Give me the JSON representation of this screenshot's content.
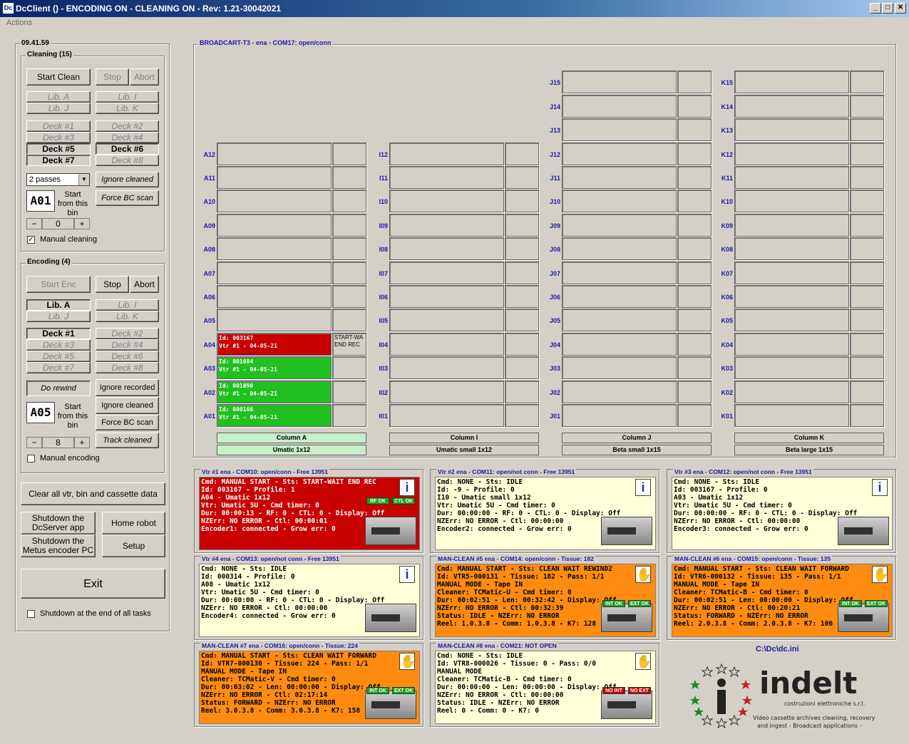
{
  "window": {
    "title": "DcClient () - ENCODING ON - CLEANING ON - Rev: 1.21-30042021",
    "app_icon": "Dc",
    "min": "_",
    "max": "□",
    "close": "✕"
  },
  "menu": {
    "actions": "Actions"
  },
  "clock": "09.41.59",
  "cleaning": {
    "title": "Cleaning (15)",
    "start": "Start Clean",
    "stop": "Stop",
    "abort": "Abort",
    "lib_a": "Lib. A",
    "lib_j": "Lib. J",
    "lib_i": "Lib. I",
    "lib_k": "Lib. K",
    "deck1": "Deck #1",
    "deck2": "Deck #2",
    "deck3": "Deck #3",
    "deck4": "Deck #4",
    "deck5": "Deck #5",
    "deck6": "Deck #6",
    "deck7": "Deck #7",
    "deck8": "Deck #8",
    "passes": "2 passes",
    "ignore_cleaned": "Ignore cleaned",
    "force_bc": "Force BC scan",
    "bin": "A01",
    "start_from": "Start from this bin",
    "spin_minus": "−",
    "spin_value": "0",
    "spin_plus": "+",
    "manual_label": "Manual cleaning",
    "manual_checked": "✓"
  },
  "encoding": {
    "title": "Encoding (4)",
    "start": "Start Enc",
    "stop": "Stop",
    "abort": "Abort",
    "lib_a": "Lib. A",
    "lib_j": "Lib. J",
    "lib_i": "Lib. I",
    "lib_k": "Lib. K",
    "deck1": "Deck #1",
    "deck2": "Deck #2",
    "deck3": "Deck #3",
    "deck4": "Deck #4",
    "deck5": "Deck #5",
    "deck6": "Deck #6",
    "deck7": "Deck #7",
    "deck8": "Deck #8",
    "do_rewind": "Do rewind",
    "ignore_recorded": "Ignore recorded",
    "ignore_cleaned": "Ignore cleaned",
    "force_bc": "Force BC scan",
    "track_cleaned": "Track cleaned",
    "bin": "A05",
    "start_from": "Start from this bin",
    "spin_minus": "−",
    "spin_value": "8",
    "spin_plus": "+",
    "manual_label": "Manual encoding"
  },
  "actions": {
    "clear": "Clear all vtr, bin and cassette data",
    "shutdown_dc": "Shutdown the DcServer app",
    "home_robot": "Home robot",
    "shutdown_metus": "Shutdown the Metus encoder PC",
    "setup": "Setup",
    "exit": "Exit",
    "shutdown_end": "Shutdown at the end of all tasks"
  },
  "robot": {
    "title": "BROADCART-T3 - ena - COM17: open/conn",
    "colA": {
      "name": "Column A",
      "type": "Umatic 1x12",
      "rows": [
        "A12",
        "A11",
        "A10",
        "A09",
        "A08",
        "A07",
        "A06",
        "A05",
        "A04",
        "A03",
        "A02",
        "A01"
      ]
    },
    "colI": {
      "name": "Column I",
      "type": "Umatic small 1x12",
      "rows": [
        "I12",
        "I11",
        "I10",
        "I09",
        "I08",
        "I07",
        "I06",
        "I05",
        "I04",
        "I03",
        "I02",
        "I01"
      ]
    },
    "colJ": {
      "name": "Column J",
      "type": "Beta small 1x15",
      "rows": [
        "J15",
        "J14",
        "J13",
        "J12",
        "J11",
        "J10",
        "J09",
        "J08",
        "J07",
        "J06",
        "J05",
        "J04",
        "J03",
        "J02",
        "J01"
      ]
    },
    "colK": {
      "name": "Column K",
      "type": "Beta large 1x15",
      "rows": [
        "K15",
        "K14",
        "K13",
        "K12",
        "K11",
        "K10",
        "K09",
        "K08",
        "K07",
        "K06",
        "K05",
        "K04",
        "K03",
        "K02",
        "K01"
      ]
    },
    "a04": {
      "l1": "Id: 003167",
      "l2": "Vtr #1 - 04-05-21",
      "side": "START-WA END REC"
    },
    "a03": {
      "l1": "Id: 001084",
      "l2": "Vtr #1 - 04-05-21"
    },
    "a02": {
      "l1": "Id: 001090",
      "l2": "Vtr #1 - 04-05-21"
    },
    "a01": {
      "l1": "Id: 000166",
      "l2": "Vtr #1 - 04-05-21"
    }
  },
  "vtrs": [
    {
      "hd": "Vtr #1 ena - COM10: open/conn - Free 13951",
      "lines": [
        "Cmd: MANUAL START - Sts: START-WAIT END REC",
        "Id: 003167 - Profile: 1",
        "A04 - Umatic 1x12",
        "Vtr: Umatic 5U - Cmd timer: 0",
        "Dur: 00:00:13 - RF: 0 - CTL: 0 - Display: Off",
        "NZErr: NO ERROR - Ctl: 00:00:01",
        "Encoder1: connected - Grow err: 0"
      ],
      "ok1": "RF OK",
      "ok2": "CTL OK"
    },
    {
      "hd": "Vtr #2 ena - COM11: open/not conn - Free 13951",
      "lines": [
        "Cmd: NONE - Sts: IDLE",
        "Id: -9 - Profile: 0",
        "I10 - Umatic small 1x12",
        "Vtr: Umatic 5U - Cmd timer: 0",
        "Dur: 00:00:00 - RF: 0 - CTL: 0 - Display: Off",
        "NZErr: NO ERROR - Ctl: 00:00:00",
        "Encoder2: connected - Grow err: 0"
      ]
    },
    {
      "hd": "Vtr #3 ena - COM12: open/not conn - Free 13951",
      "lines": [
        "Cmd: NONE - Sts: IDLE",
        "Id: 003167 - Profile: 0",
        "A03 - Umatic 1x12",
        "Vtr: Umatic 5U - Cmd timer: 0",
        "Dur: 00:00:00 - RF: 0 - CTL: 0 - Display: Off",
        "NZErr: NO ERROR - Ctl: 00:00:00",
        "Encoder3: connected - Grow err: 0"
      ]
    },
    {
      "hd": "Vtr #4 ena - COM13: open/not conn - Free 13951",
      "lines": [
        "Cmd: NONE - Sts: IDLE",
        "Id: 000314 - Profile: 0",
        "A08 - Umatic 1x12",
        "Vtr: Umatic 5U - Cmd timer: 0",
        "Dur: 00:00:00 - RF: 0 - CTL: 0 - Display: Off",
        "NZErr: NO ERROR - Ctl: 00:00:00",
        "Encoder4: connected - Grow err: 0"
      ]
    },
    {
      "hd": "MAN-CLEAN #5 ena - COM14: open/conn - Tissue: 182",
      "lines": [
        "Cmd: MANUAL START - Sts: CLEAN WAIT REWIND2",
        "Id: VTR5-000131 - Tissue: 182 - Pass: 1/1",
        "MANUAL MODE - Tape IN",
        "Cleaner: TCMatic-U - Cmd timer: 0",
        "Dur: 00:02:51 - Len: 00:32:42 - Display: Off",
        "NZErr: NO ERROR - Ctl: 00:32:39",
        "Status: IDLE - NZErr: NO ERROR",
        "Reel: 1.0.3.8 - Comm: 1.0.3.8 - K7: 128"
      ],
      "ok1": "INT OK",
      "ok2": "EXT OK"
    },
    {
      "hd": "MAN-CLEAN #6 ena - COM15: open/conn - Tissue: 135",
      "lines": [
        "Cmd: MANUAL START - Sts: CLEAN WAIT FORWARD",
        "Id: VTR6-000132 - Tissue: 135 - Pass: 1/1",
        "MANUAL MODE - Tape IN",
        "Cleaner: TCMatic-B - Cmd timer: 0",
        "Dur: 00:02:51 - Len: 00:00:00 - Display: Off",
        "NZErr: NO ERROR - Ctl: 00:20:21",
        "Status: FORWARD - NZErr: NO ERROR",
        "Reel: 2.0.3.8 - Comm: 2.0.3.8 - K7: 106"
      ],
      "ok1": "INT OK",
      "ok2": "EXT OK"
    },
    {
      "hd": "MAN-CLEAN #7 ena - COM16: open/conn - Tissue: 224",
      "lines": [
        "Cmd: MANUAL START - Sts: CLEAN WAIT FORWARD",
        "Id: VTR7-000130 - Tissue: 224 - Pass: 1/1",
        "MANUAL MODE - Tape IN",
        "Cleaner: TCMatic-V - Cmd timer: 0",
        "Dur: 00:03:02 - Len: 00:00:00 - Display: Off",
        "NZErr: NO ERROR - Ctl: 02:17:14",
        "Status: FORWARD - NZErr: NO ERROR",
        "Reel: 3.0.3.8 - Comm: 3.0.3.8 - K7: 158"
      ],
      "ok1": "INT OK",
      "ok2": "EXT OK"
    },
    {
      "hd": "MAN-CLEAN #8 ena - COM21: NOT OPEN",
      "lines": [
        "Cmd: NONE - Sts: IDLE",
        "Id: VTR8-000026 - Tissue: 0 - Pass: 0/0",
        "MANUAL MODE",
        "Cleaner: TCMatic-B - Cmd timer: 0",
        "Dur: 00:00:00 - Len: 00:00:00 - Display: Off",
        "NZErr: NO ERROR - Ctl: 00:00:00",
        "Status: IDLE - NZErr: NO ERROR",
        "Reel: 0 - Comm: 0 - K7: 0"
      ],
      "ok1": "NO INT",
      "ok2": "NO EXT"
    }
  ],
  "ini": "C:\\Dc\\dc.ini",
  "logo": {
    "name": "indelt",
    "sub": "costruzioni elettroniche s.r.l.",
    "tag1": "Video cassette archives cleaning, recovery",
    "tag2": "and ingest - Broadcast applications -"
  }
}
